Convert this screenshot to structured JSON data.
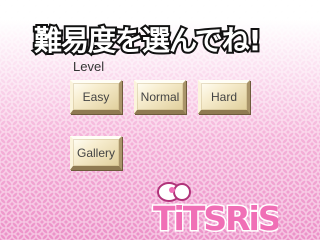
{
  "title": "難易度を選んでね!",
  "level_label": "Level",
  "buttons": {
    "easy": "Easy",
    "normal": "Normal",
    "hard": "Hard",
    "gallery": "Gallery"
  },
  "logo_text": "TiTSRiS",
  "colors": {
    "background_pink": "#f2a9d4",
    "logo_pink": "#f06fb6",
    "button_face": "#f7edcf"
  }
}
